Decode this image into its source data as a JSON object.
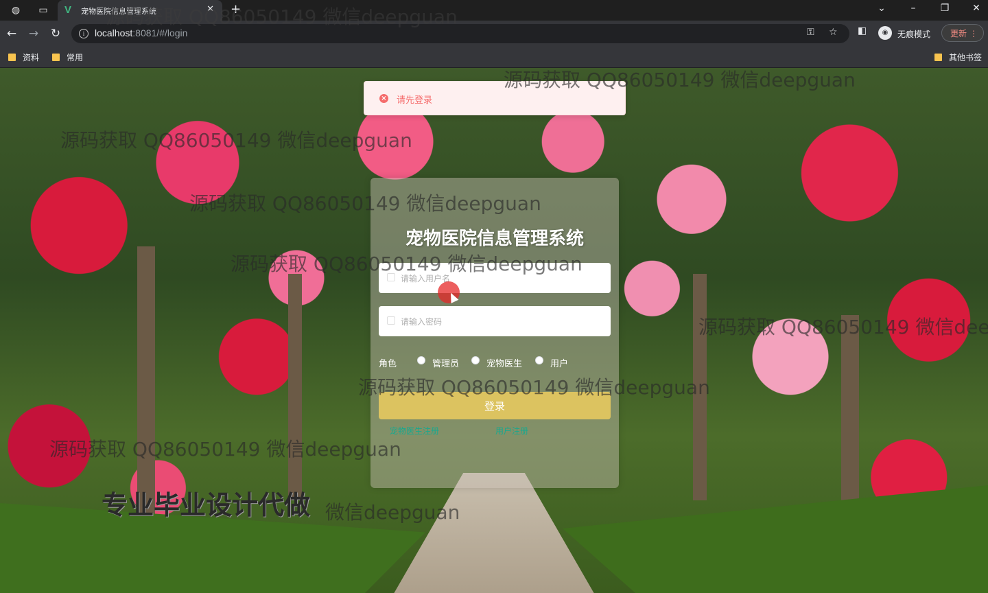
{
  "browser": {
    "tab_title": "宠物医院信息管理系统",
    "tab_favicon": "V",
    "url_host": "localhost",
    "url_rest": ":8081/#/login",
    "incognito_label": "无痕模式",
    "update_label": "更新",
    "bookmarks": [
      "资料",
      "常用"
    ],
    "other_bookmarks": "其他书签",
    "icons": [
      "back-icon",
      "forward-icon",
      "reload-icon",
      "info-icon",
      "key-icon",
      "star-icon",
      "sidebar-icon",
      "incognito-icon",
      "menu-icon"
    ]
  },
  "toast": {
    "message": "请先登录",
    "color": "#f56c6c"
  },
  "login": {
    "title": "宠物医院信息管理系统",
    "username_placeholder": "请输入用户名",
    "password_placeholder": "请输入密码",
    "role_label": "角色",
    "roles": [
      "管理员",
      "宠物医生",
      "用户"
    ],
    "login_button": "登录",
    "register_links": [
      "宠物医生注册",
      "用户注册"
    ],
    "button_color": "#e4c85f",
    "link_color": "#17a98f"
  },
  "watermarks": {
    "text": "源码获取 QQ86050149 微信deepguan",
    "bottom_text": "微信deepguan",
    "overlay": "专业毕业设计代做"
  }
}
